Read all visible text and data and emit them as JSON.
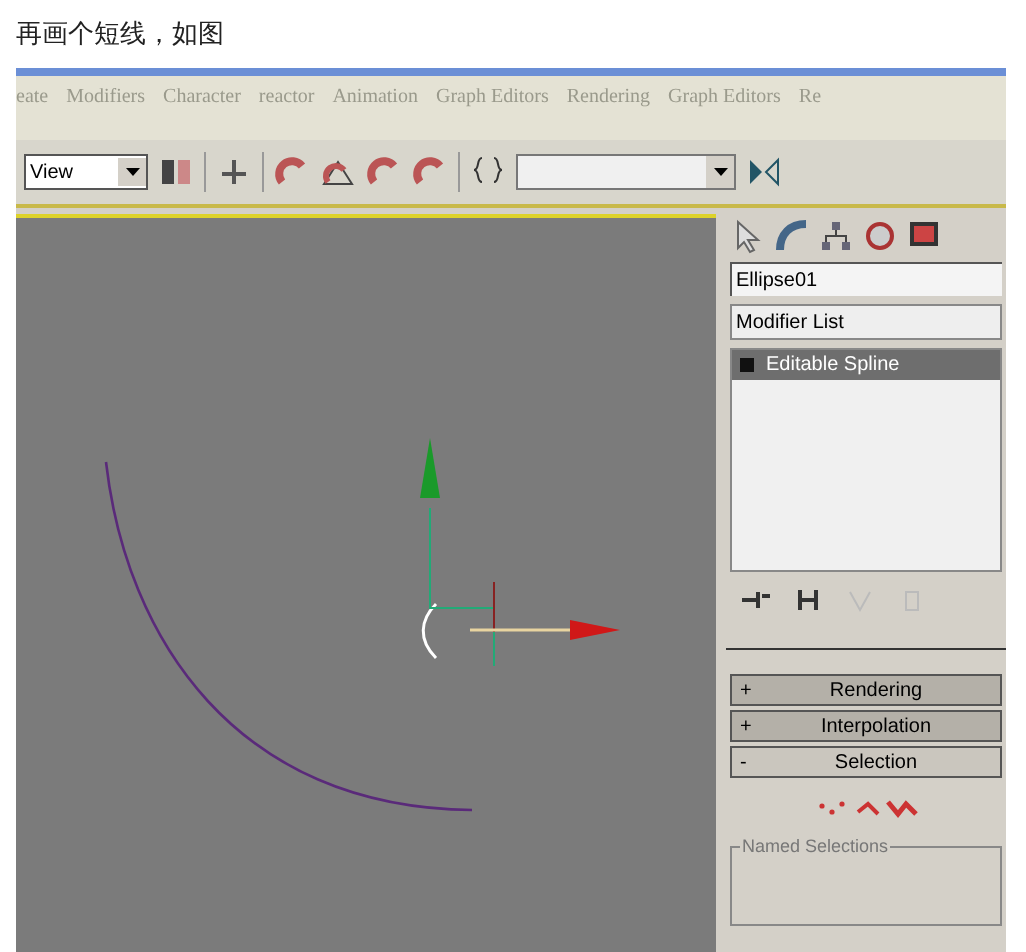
{
  "caption": "再画个短线，如图",
  "menu": [
    "eate",
    "Modifiers",
    "Character",
    "reactor",
    "Animation",
    "Graph Editors",
    "Rendering",
    "Graph Editors",
    "Re"
  ],
  "toolbar": {
    "view_dropdown": "View"
  },
  "panel": {
    "object_name": "Ellipse01",
    "modifier_list": "Modifier List",
    "stack": [
      {
        "label": "Editable Spline",
        "selected": true
      }
    ],
    "rollouts": [
      {
        "sign": "+",
        "title": "Rendering",
        "expanded": false
      },
      {
        "sign": "+",
        "title": "Interpolation",
        "expanded": false
      },
      {
        "sign": "-",
        "title": "Selection",
        "expanded": true
      }
    ],
    "named_selections": "Named Selections"
  }
}
